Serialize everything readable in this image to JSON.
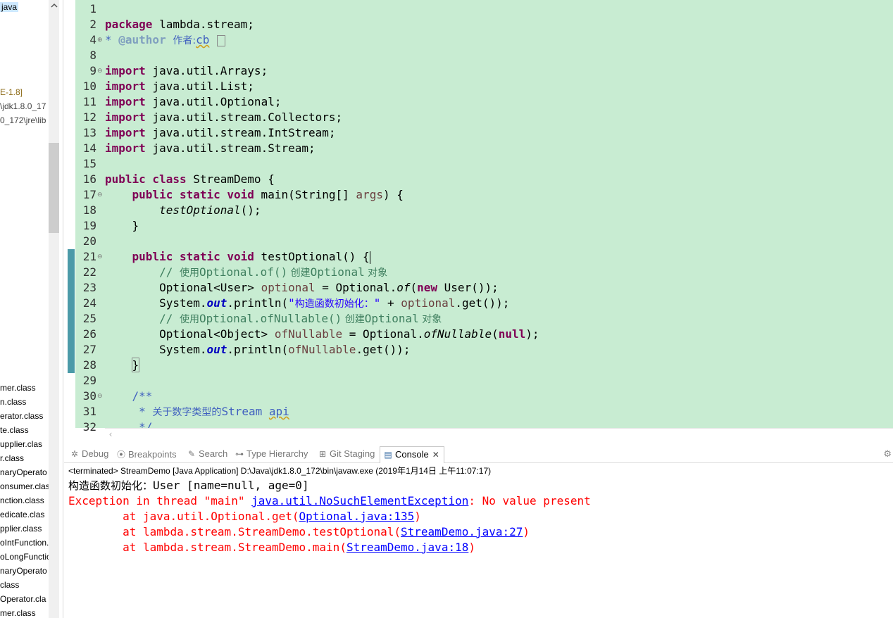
{
  "package_explorer": {
    "items": [
      {
        "text": "java",
        "selected": true
      },
      {
        "text": "E-1.8]"
      },
      {
        "text": "\\jdk1.8.0_17"
      },
      {
        "text": "0_172\\jre\\lib"
      },
      {
        "text": "mer.class"
      },
      {
        "text": "n.class"
      },
      {
        "text": "erator.class"
      },
      {
        "text": "te.class"
      },
      {
        "text": "upplier.clas"
      },
      {
        "text": "r.class"
      },
      {
        "text": "naryOperato"
      },
      {
        "text": "onsumer.clas"
      },
      {
        "text": "nction.class"
      },
      {
        "text": "edicate.clas"
      },
      {
        "text": "pplier.class"
      },
      {
        "text": "oIntFunction."
      },
      {
        "text": "oLongFunctio"
      },
      {
        "text": "naryOperato"
      },
      {
        "text": "class"
      },
      {
        "text": "Operator.cla"
      },
      {
        "text": "mer.class"
      }
    ],
    "collapse_icon": "chevron-up-icon"
  },
  "editor": {
    "line_numbers": [
      "1",
      "2",
      "4",
      "8",
      "9",
      "10",
      "11",
      "12",
      "13",
      "14",
      "15",
      "16",
      "17",
      "18",
      "19",
      "20",
      "21",
      "22",
      "23",
      "24",
      "25",
      "26",
      "27",
      "28",
      "29",
      "30",
      "31",
      "32"
    ],
    "code": {
      "l2_kw": "package",
      "l2_rest": " lambda.stream;",
      "l4_star": "* ",
      "l4_tag": "@author",
      "l4_sp": " ",
      "l4_cjk": "作者:",
      "l4_name": "cb",
      "l4_box": " ",
      "imports": [
        "java.util.Arrays;",
        "java.util.List;",
        "java.util.Optional;",
        "java.util.stream.Collectors;",
        "java.util.stream.IntStream;",
        "java.util.stream.Stream;"
      ],
      "import_kw": "import",
      "l16_kw": "public class",
      "l16_rest": " StreamDemo {",
      "l17_kw": "public static void",
      "l17_rest": " main(String[] ",
      "l17_var": "args",
      "l17_end": ") {",
      "l18_call": "testOptional",
      "l18_end": "();",
      "l19": "}",
      "l21_kw": "public static void",
      "l21_rest": " testOptional() {",
      "l22_cm": "// ",
      "l22_cjk1": "使用",
      "l22_code": "Optional.of()",
      "l22_cjk2": " 创建",
      "l22_code2": "Optional",
      "l22_cjk3": " 对象",
      "l23_a": "Optional<User> ",
      "l23_var": "optional",
      "l23_b": " = Optional.",
      "l23_it": "of",
      "l23_c": "(",
      "l23_kw": "new",
      "l23_d": " User());",
      "l24_a": "System.",
      "l24_fld": "out",
      "l24_b": ".println(",
      "l24_str1": "\"",
      "l24_cjk": "构造函数初始化：",
      "l24_str2": "\"",
      "l24_c": " + ",
      "l24_var": "optional",
      "l24_d": ".get());",
      "l25_cm": "// ",
      "l25_cjk1": "使用",
      "l25_code": "Optional.ofNullable()",
      "l25_cjk2": " 创建",
      "l25_code2": "Optional",
      "l25_cjk3": " 对象",
      "l26_a": "Optional<Object> ",
      "l26_var": "ofNullable",
      "l26_b": " = Optional.",
      "l26_it": "ofNullable",
      "l26_c": "(",
      "l26_kw": "null",
      "l26_d": ");",
      "l27_a": "System.",
      "l27_fld": "out",
      "l27_b": ".println(",
      "l27_var": "ofNullable",
      "l27_c": ".get());",
      "l28": "}",
      "l30": "/**",
      "l31_a": " * ",
      "l31_cjk": "关于数字类型的",
      "l31_b": "Stream ",
      "l31_c": "api",
      "l32": " */"
    }
  },
  "views": {
    "tabs": [
      {
        "label": "Debug",
        "icon": "bug-icon"
      },
      {
        "label": "Breakpoints",
        "icon": "breakpoints-icon"
      },
      {
        "label": "Search",
        "icon": "search-icon"
      },
      {
        "label": "Type Hierarchy",
        "icon": "hierarchy-icon"
      },
      {
        "label": "Git Staging",
        "icon": "git-staging-icon"
      },
      {
        "label": "Console",
        "icon": "console-icon",
        "active": true
      }
    ],
    "close_symbol": "✕",
    "menu_icon": "view-menu-icon"
  },
  "console": {
    "status": "<terminated> StreamDemo [Java Application] D:\\Java\\jdk1.8.0_172\\bin\\javaw.exe (2019年1月14日 上午11:07:17)",
    "out_cjk": "构造函数初始化：",
    "out_rest": "User [name=null, age=0]",
    "err1_a": "Exception in thread \"main\" ",
    "err1_link": "java.util.NoSuchElementException",
    "err1_b": ": No value present",
    "trace": [
      {
        "prefix": "        at java.util.Optional.get(",
        "link": "Optional.java:135",
        "suffix": ")"
      },
      {
        "prefix": "        at lambda.stream.StreamDemo.testOptional(",
        "link": "StreamDemo.java:27",
        "suffix": ")"
      },
      {
        "prefix": "        at lambda.stream.StreamDemo.main(",
        "link": "StreamDemo.java:18",
        "suffix": ")"
      }
    ]
  }
}
